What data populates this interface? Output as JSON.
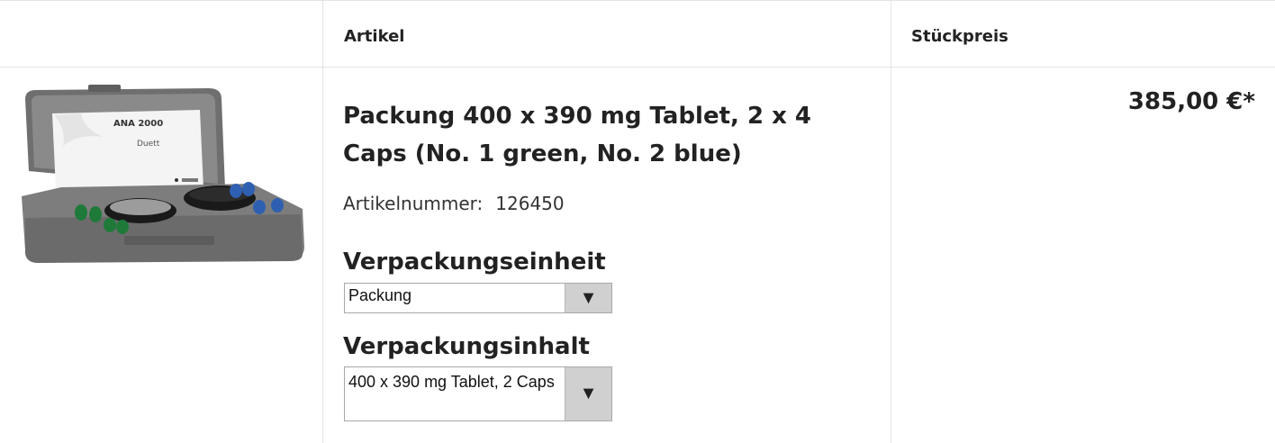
{
  "header": {
    "col_article": "Artikel",
    "col_price": "Stückpreis"
  },
  "product": {
    "image_label": "ANA 2000",
    "image_sublabel": "Duett",
    "title": "Packung 400 x 390 mg Tablet, 2 x 4 Caps (No. 1 green, No. 2 blue)",
    "article_number_label": "Artikelnummer:",
    "article_number": "126450",
    "packaging_unit_label": "Verpackungseinheit",
    "packaging_unit_value": "Packung",
    "packaging_content_label": "Verpackungsinhalt",
    "packaging_content_value": "400 x 390 mg Tablet, 2 Caps",
    "price": "385,00 €*"
  },
  "icons": {
    "dropdown": "chevron-down-icon"
  },
  "colors": {
    "border": "#e3e3e3",
    "text": "#222222",
    "select_button": "#d0d0d0",
    "case_gray": "#7d7d7d",
    "cap_green": "#1f7a3a",
    "cap_blue": "#2f5fb0"
  }
}
